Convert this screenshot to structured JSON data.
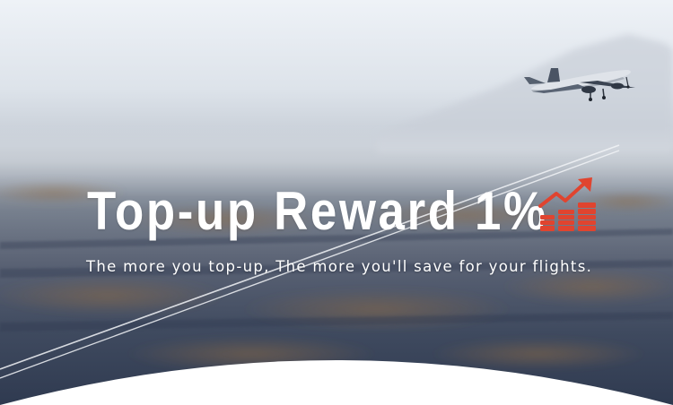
{
  "banner": {
    "headline": "Top-up Reward 1%",
    "subtitle": "The more you top-up, The more you'll save for your flights."
  },
  "icons": {
    "reward": "rising-coins-arrow-icon",
    "airplane": "airplane-icon"
  },
  "colors": {
    "sky_top": "#e9eef4",
    "haze": "#b9c1cb",
    "land_dark": "#3a4a62",
    "accent_red": "#e0442f",
    "text": "#ffffff"
  }
}
